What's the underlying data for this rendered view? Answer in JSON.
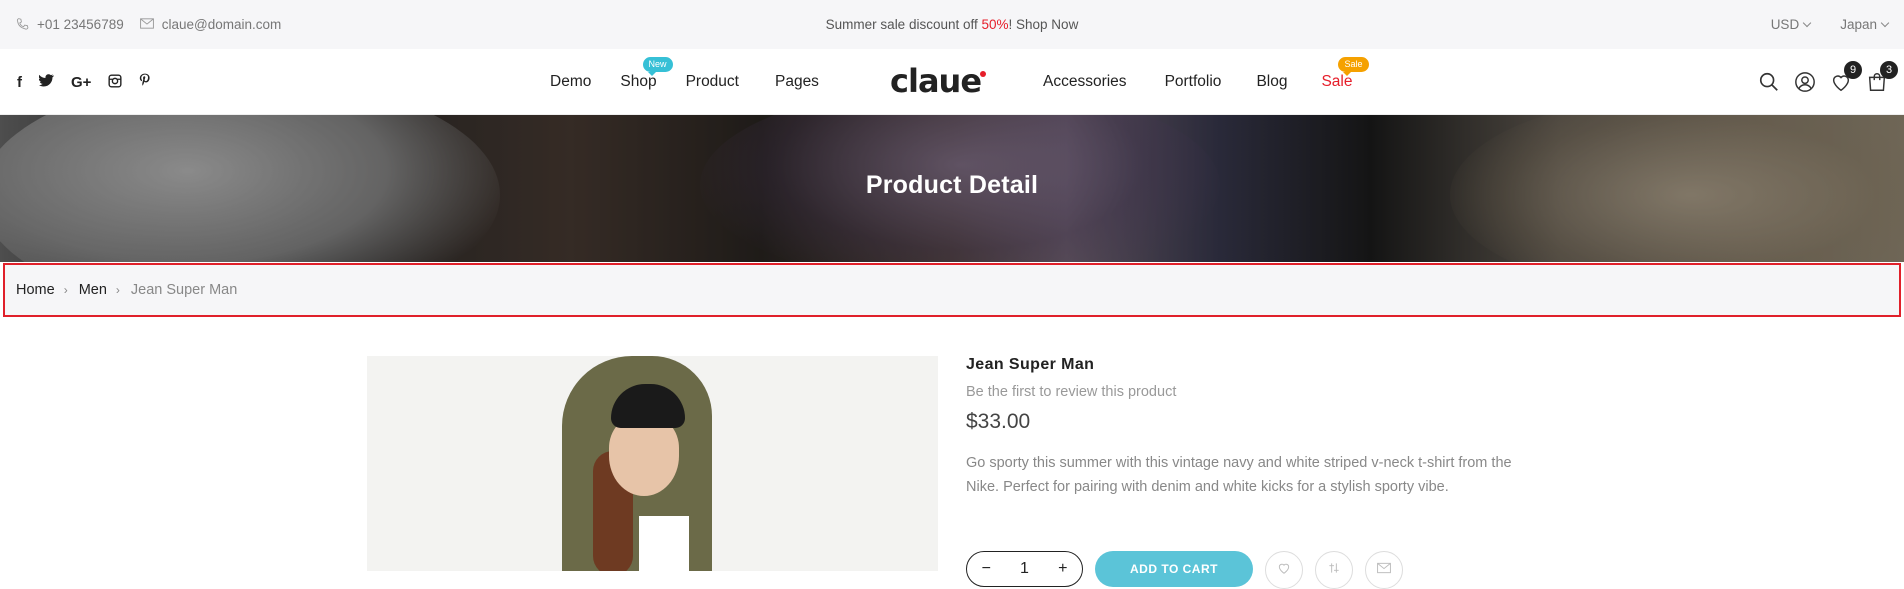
{
  "topbar": {
    "phone": "+01 23456789",
    "email": "claue@domain.com",
    "promo_prefix": "Summer sale discount off ",
    "promo_pct": "50%",
    "promo_suffix": "! Shop Now",
    "currency": "USD",
    "region": "Japan"
  },
  "header": {
    "social": [
      "f",
      "t",
      "G+",
      "ig",
      "p"
    ],
    "nav_left": [
      {
        "label": "Demo"
      },
      {
        "label": "Shop",
        "badge": "New",
        "badge_color": "#36c0d6"
      },
      {
        "label": "Product"
      },
      {
        "label": "Pages"
      }
    ],
    "logo": "claue",
    "nav_right": [
      {
        "label": "Accessories"
      },
      {
        "label": "Portfolio"
      },
      {
        "label": "Blog"
      },
      {
        "label": "Sale",
        "badge": "Sale",
        "badge_color": "#f5a100"
      }
    ],
    "wishlist_count": "9",
    "cart_count": "3",
    "accent_color": "#e61e2a"
  },
  "banner": {
    "title": "Product Detail"
  },
  "breadcrumb": {
    "home": "Home",
    "category": "Men",
    "current": "Jean Super Man"
  },
  "product": {
    "name": "Jean Super Man",
    "review_text": "Be the first to review this product",
    "price": "$33.00",
    "description": "Go sporty this summer with this vintage navy and white striped v-neck t-shirt from the Nike. Perfect for pairing with denim and white kicks for a stylish sporty vibe.",
    "qty_minus": "−",
    "qty_value": "1",
    "qty_plus": "+",
    "add_to_cart": "ADD TO CART"
  }
}
